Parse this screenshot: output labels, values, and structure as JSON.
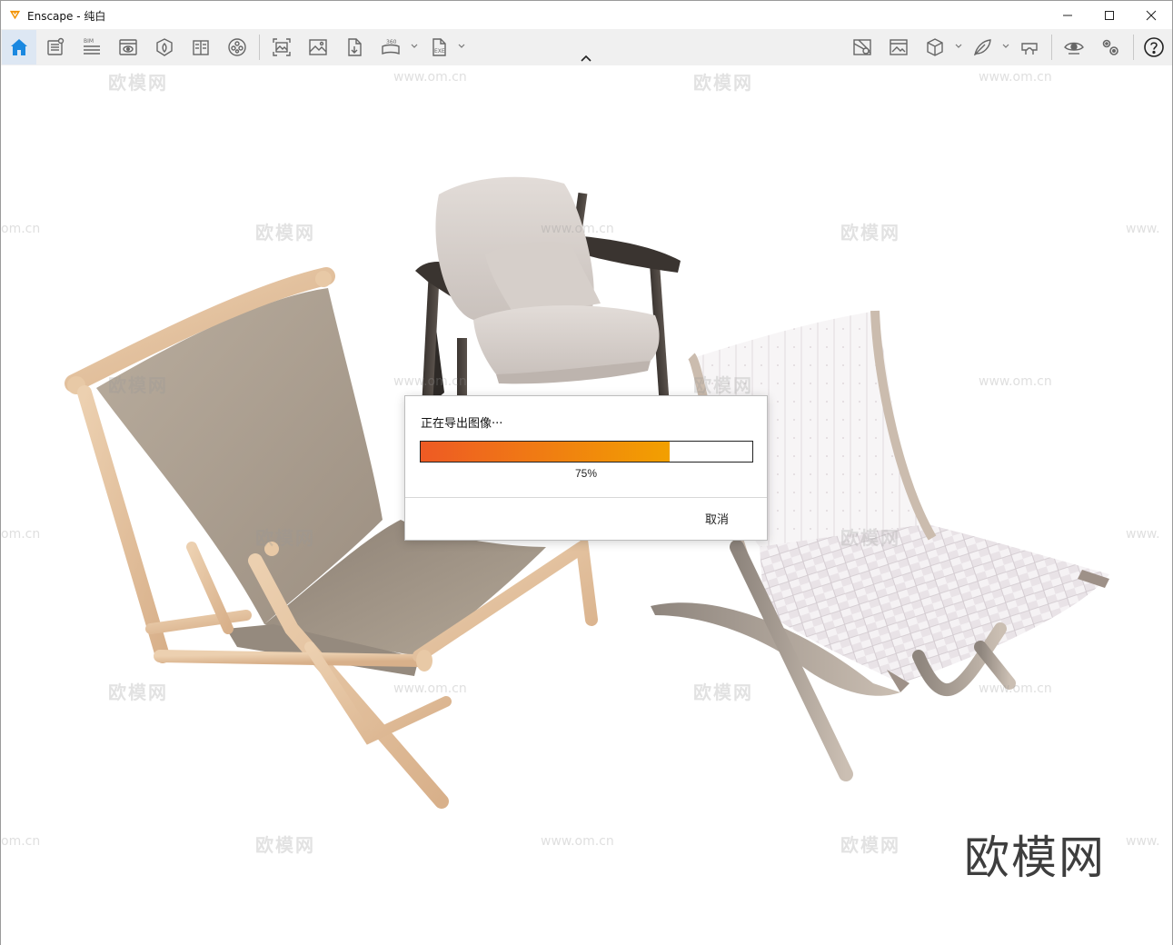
{
  "window": {
    "title": "Enscape - 纯白",
    "controls": [
      "minimize",
      "maximize",
      "close"
    ]
  },
  "toolbar": {
    "left_tools": [
      {
        "icon": "home-icon",
        "active": true
      },
      {
        "icon": "views-list-icon"
      },
      {
        "icon": "bim-icon"
      },
      {
        "icon": "visibility-monitor-icon"
      },
      {
        "icon": "assets-icon"
      },
      {
        "icon": "book-icon"
      },
      {
        "icon": "video-reel-icon"
      },
      {
        "icon": "render-image-icon"
      },
      {
        "icon": "image-icon"
      },
      {
        "icon": "file-export-icon"
      },
      {
        "icon": "panorama-360-icon",
        "dropdown": true
      },
      {
        "icon": "exe-export-icon",
        "dropdown": true
      }
    ],
    "right_tools": [
      {
        "icon": "map-icon"
      },
      {
        "icon": "image-gallery-icon"
      },
      {
        "icon": "cube-icon",
        "dropdown": true
      },
      {
        "icon": "material-feather-icon",
        "dropdown": true
      },
      {
        "icon": "vr-headset-icon"
      },
      {
        "icon": "eye-icon"
      },
      {
        "icon": "settings-gears-icon"
      },
      {
        "icon": "help-icon"
      }
    ],
    "bim_label": "BIM",
    "pano_label": "360",
    "exe_label": "EXE"
  },
  "scene": {
    "watermark_text": "欧模网",
    "watermark_url": "www.om.cn",
    "watermark_url_partial_left": "om.cn",
    "watermark_url_partial_right": "www.",
    "brand_mark": "欧模网"
  },
  "dialog": {
    "title": "正在导出图像···",
    "progress": 0.75,
    "progress_label": "75%",
    "cancel_label": "取消",
    "progress_color_start": "#ee5a24",
    "progress_color_end": "#f2a000"
  }
}
